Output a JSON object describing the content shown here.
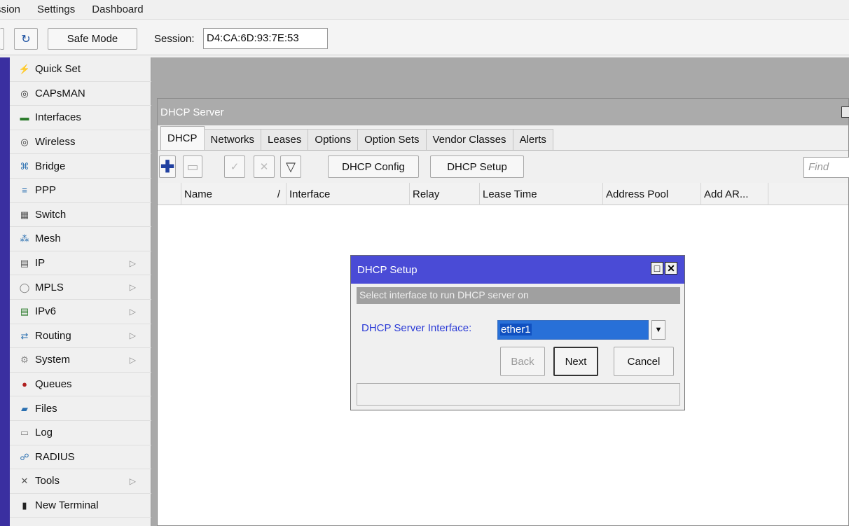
{
  "menubar": {
    "items": [
      "ssion",
      "Settings",
      "Dashboard"
    ]
  },
  "toolbar": {
    "redo_glyph": "↻",
    "safe_mode": "Safe Mode",
    "session_label": "Session:",
    "session_value": "D4:CA:6D:93:7E:53"
  },
  "sidebar": {
    "items": [
      {
        "label": "Quick Set",
        "icon": "wand-icon",
        "glyph": "⚡",
        "color": "#7a6a2a",
        "submenu": false
      },
      {
        "label": "CAPsMAN",
        "icon": "antenna-icon",
        "glyph": "◎",
        "color": "#333",
        "submenu": false
      },
      {
        "label": "Interfaces",
        "icon": "interfaces-icon",
        "glyph": "▬",
        "color": "#2a7a2a",
        "submenu": false
      },
      {
        "label": "Wireless",
        "icon": "wireless-icon",
        "glyph": "◎",
        "color": "#333",
        "submenu": false
      },
      {
        "label": "Bridge",
        "icon": "bridge-icon",
        "glyph": "⌘",
        "color": "#2a6fb0",
        "submenu": false
      },
      {
        "label": "PPP",
        "icon": "ppp-icon",
        "glyph": "≡",
        "color": "#2a6fb0",
        "submenu": false
      },
      {
        "label": "Switch",
        "icon": "switch-icon",
        "glyph": "▦",
        "color": "#555",
        "submenu": false
      },
      {
        "label": "Mesh",
        "icon": "mesh-icon",
        "glyph": "⁂",
        "color": "#2a6fb0",
        "submenu": false
      },
      {
        "label": "IP",
        "icon": "ip-icon",
        "glyph": "▤",
        "color": "#555",
        "submenu": true
      },
      {
        "label": "MPLS",
        "icon": "mpls-icon",
        "glyph": "◯",
        "color": "#777",
        "submenu": true
      },
      {
        "label": "IPv6",
        "icon": "ipv6-icon",
        "glyph": "▤",
        "color": "#2a7a2a",
        "submenu": true
      },
      {
        "label": "Routing",
        "icon": "routing-icon",
        "glyph": "⇄",
        "color": "#2a6fb0",
        "submenu": true
      },
      {
        "label": "System",
        "icon": "system-icon",
        "glyph": "⚙",
        "color": "#888",
        "submenu": true
      },
      {
        "label": "Queues",
        "icon": "queues-icon",
        "glyph": "●",
        "color": "#b02020",
        "submenu": false
      },
      {
        "label": "Files",
        "icon": "files-icon",
        "glyph": "▰",
        "color": "#2a6fb0",
        "submenu": false
      },
      {
        "label": "Log",
        "icon": "log-icon",
        "glyph": "▭",
        "color": "#888",
        "submenu": false
      },
      {
        "label": "RADIUS",
        "icon": "radius-icon",
        "glyph": "☍",
        "color": "#2a6fb0",
        "submenu": false
      },
      {
        "label": "Tools",
        "icon": "tools-icon",
        "glyph": "✕",
        "color": "#555",
        "submenu": true
      },
      {
        "label": "New Terminal",
        "icon": "terminal-icon",
        "glyph": "▮",
        "color": "#222",
        "submenu": false
      }
    ],
    "submenu_glyph": "▷"
  },
  "dhcp_window": {
    "title": "DHCP Server",
    "tabs": [
      "DHCP",
      "Networks",
      "Leases",
      "Options",
      "Option Sets",
      "Vendor Classes",
      "Alerts"
    ],
    "actions": {
      "add": "✚",
      "remove": "▭",
      "enable": "✓",
      "disable": "✕",
      "filter": "▽",
      "config": "DHCP Config",
      "setup": "DHCP Setup"
    },
    "find_placeholder": "Find",
    "columns": [
      "Name",
      "Interface",
      "Relay",
      "Lease Time",
      "Address Pool",
      "Add AR..."
    ],
    "sort_glyph": "/"
  },
  "setup_dialog": {
    "title": "DHCP Setup",
    "hint": "Select interface to run DHCP server on",
    "field_label": "DHCP Server Interface:",
    "field_value": "ether1",
    "dropdown_glyph": "▼",
    "back": "Back",
    "next": "Next",
    "cancel": "Cancel",
    "max_glyph": "□",
    "close_glyph": "✕"
  }
}
